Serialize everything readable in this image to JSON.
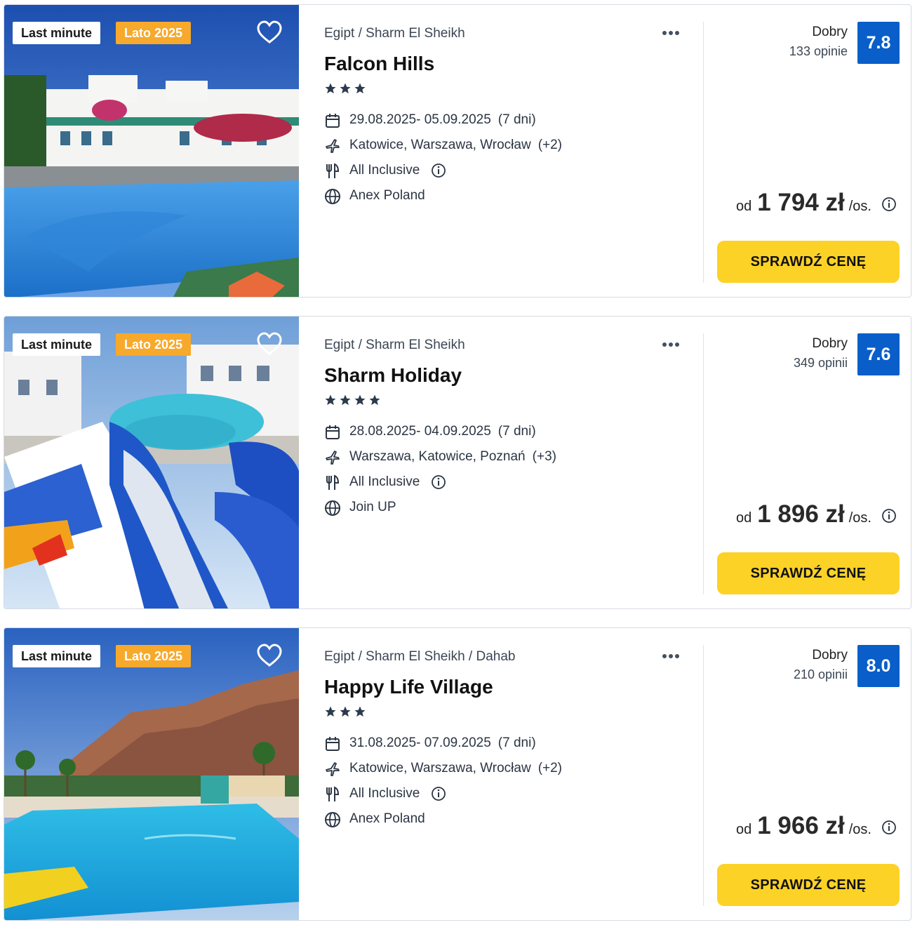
{
  "offers": [
    {
      "badges": {
        "last_minute": "Last minute",
        "season": "Lato 2025"
      },
      "location": "Egipt / Sharm El Sheikh",
      "name": "Falcon Hills",
      "stars": 3,
      "dates": "29.08.2025- 05.09.2025",
      "duration": "(7 dni)",
      "departure": "Katowice, Warszawa, Wrocław",
      "departure_more": "(+2)",
      "board": "All Inclusive",
      "operator": "Anex Poland",
      "rating_word": "Dobry",
      "rating_count": "133 opinie",
      "rating_score": "7.8",
      "price_prefix": "od",
      "price": "1 794 zł",
      "price_suffix": "/os.",
      "cta": "SPRAWDŹ CENĘ",
      "photo_scene": "pool-resort-white-buildings"
    },
    {
      "badges": {
        "last_minute": "Last minute",
        "season": "Lato 2025"
      },
      "location": "Egipt / Sharm El Sheikh",
      "name": "Sharm Holiday",
      "stars": 4,
      "dates": "28.08.2025- 04.09.2025",
      "duration": "(7 dni)",
      "departure": "Warszawa, Katowice, Poznań",
      "departure_more": "(+3)",
      "board": "All Inclusive",
      "operator": "Join UP",
      "rating_word": "Dobry",
      "rating_count": "349 opinii",
      "rating_score": "7.6",
      "price_prefix": "od",
      "price": "1 896 zł",
      "price_suffix": "/os.",
      "cta": "SPRAWDŹ CENĘ",
      "photo_scene": "waterslides-pool"
    },
    {
      "badges": {
        "last_minute": "Last minute",
        "season": "Lato 2025"
      },
      "location": "Egipt / Sharm El Sheikh / Dahab",
      "name": "Happy Life Village",
      "stars": 3,
      "dates": "31.08.2025- 07.09.2025",
      "duration": "(7 dni)",
      "departure": "Katowice, Warszawa, Wrocław",
      "departure_more": "(+2)",
      "board": "All Inclusive",
      "operator": "Anex Poland",
      "rating_word": "Dobry",
      "rating_count": "210 opinii",
      "rating_score": "8.0",
      "price_prefix": "od",
      "price": "1 966 zł",
      "price_suffix": "/os.",
      "cta": "SPRAWDŹ CENĘ",
      "photo_scene": "pool-mountains-palms"
    }
  ],
  "colors": {
    "badge_season": "#f7a92c",
    "rating_box": "#0a5ec9",
    "cta": "#fdd226",
    "star": "#2b3a4c"
  },
  "icons": {
    "favorite": "heart-outline-icon",
    "more": "more-dots-icon",
    "date": "calendar-icon",
    "departure": "plane-icon",
    "board": "cutlery-icon",
    "board_info": "info-icon",
    "operator": "globe-icon",
    "price_info": "info-icon"
  }
}
